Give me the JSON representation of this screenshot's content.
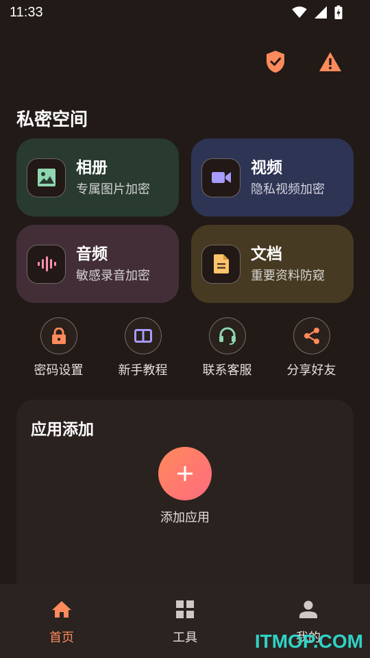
{
  "status_bar": {
    "time": "11:33"
  },
  "header": {
    "title": "私密空间"
  },
  "top_actions": [
    {
      "icon": "shield-check-icon",
      "color": "#ff8a5b"
    },
    {
      "icon": "warning-icon",
      "color": "#ff8a5b"
    }
  ],
  "cards": [
    {
      "title": "相册",
      "subtitle": "专属图片加密",
      "icon": "image-icon",
      "bg": "#293a2f",
      "accent": "#8fd6b0"
    },
    {
      "title": "视频",
      "subtitle": "隐私视频加密",
      "icon": "video-camera-icon",
      "bg": "#2e3454",
      "accent": "#a79bff"
    },
    {
      "title": "音频",
      "subtitle": "敏感录音加密",
      "icon": "audio-wave-icon",
      "bg": "#432e38",
      "accent": "#ff8fb0"
    },
    {
      "title": "文档",
      "subtitle": "重要资料防窥",
      "icon": "document-icon",
      "bg": "#473a22",
      "accent": "#ffc46b"
    }
  ],
  "quick_actions": [
    {
      "label": "密码设置",
      "icon": "lock-icon",
      "color": "#ff8a5b"
    },
    {
      "label": "新手教程",
      "icon": "book-icon",
      "color": "#a79bff"
    },
    {
      "label": "联系客服",
      "icon": "headset-icon",
      "color": "#8fd6b0"
    },
    {
      "label": "分享好友",
      "icon": "share-icon",
      "color": "#ff8a5b"
    }
  ],
  "app_panel": {
    "title": "应用添加",
    "add_label": "添加应用"
  },
  "bottom_nav": [
    {
      "label": "首页",
      "icon": "home-icon",
      "active": true
    },
    {
      "label": "工具",
      "icon": "grid-icon",
      "active": false
    },
    {
      "label": "我的",
      "icon": "person-icon",
      "active": false
    }
  ],
  "watermark": "ITMOP.COM",
  "colors": {
    "accent": "#ff8a5b",
    "background": "#211a17"
  }
}
